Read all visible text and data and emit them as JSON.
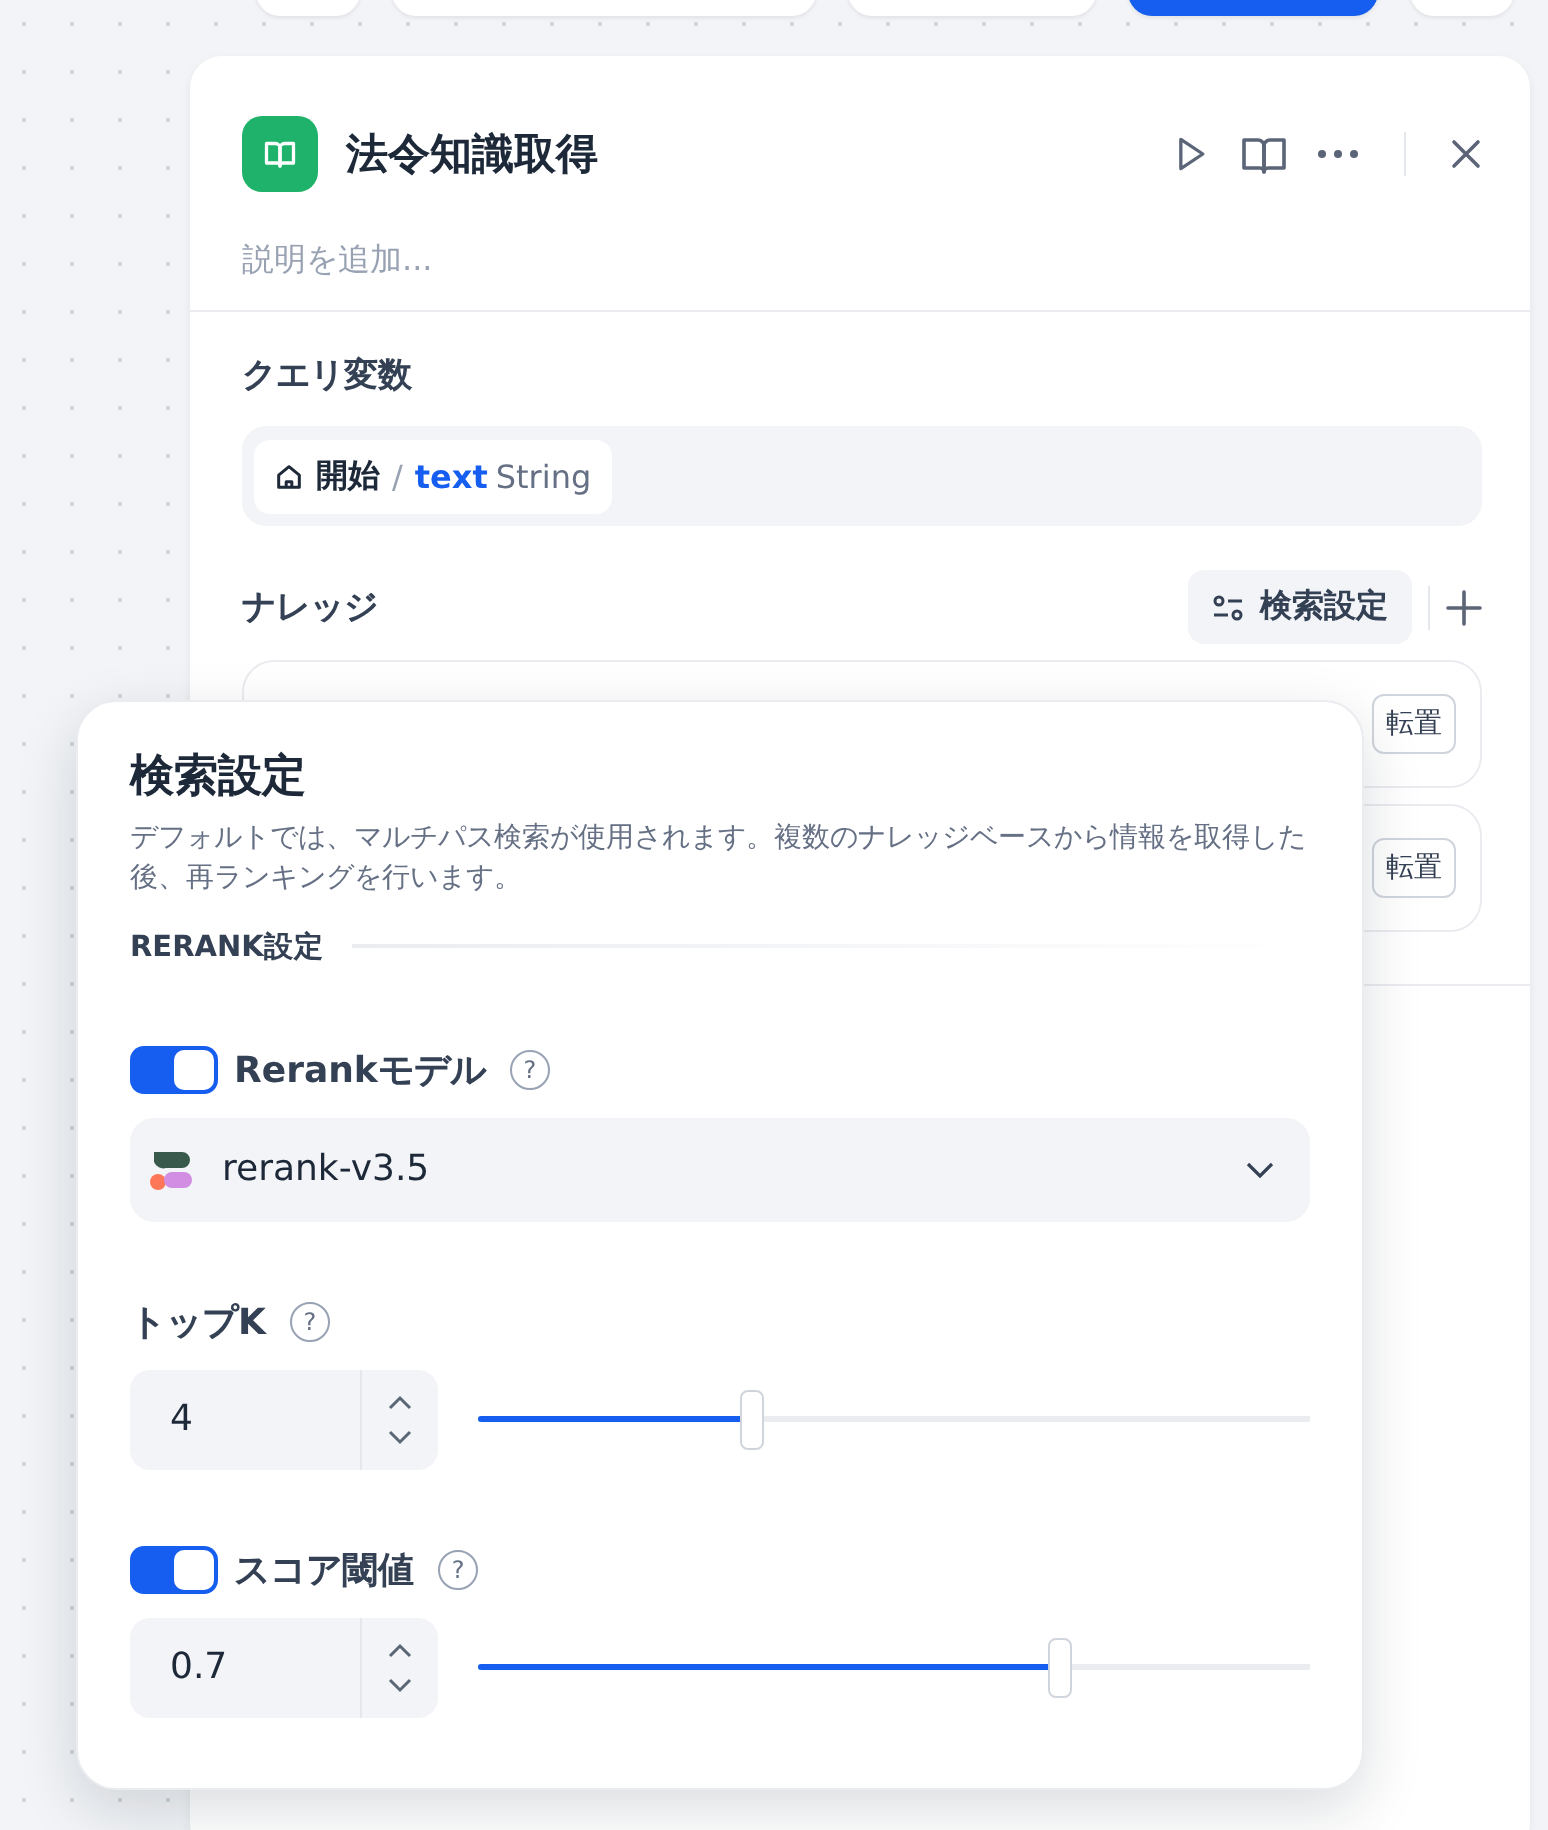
{
  "top_toolbar": {
    "buttons": [
      {
        "kind": "default"
      },
      {
        "kind": "default"
      },
      {
        "kind": "default"
      },
      {
        "kind": "primary"
      },
      {
        "kind": "default"
      }
    ]
  },
  "node": {
    "title": "法令知識取得",
    "description": {
      "placeholder": "説明を追加..."
    },
    "query_variable": {
      "label": "クエリ変数",
      "source": "開始",
      "separator": "/",
      "variable": "text",
      "type": "String"
    },
    "knowledge": {
      "label": "ナレッジ",
      "settings_button": "検索設定",
      "items": [
        {
          "action": "転置"
        },
        {
          "action": "転置"
        }
      ]
    }
  },
  "popover": {
    "title": "検索設定",
    "description": "デフォルトでは、マルチパス検索が使用されます。複数のナレッジベースから情報を取得した後、再ランキングを行います。",
    "section": "RERANK設定",
    "rerank_model": {
      "on": true,
      "label": "Rerankモデル",
      "help": "?",
      "model": "rerank-v3.5"
    },
    "top_k": {
      "label": "トップK",
      "help": "?",
      "value": "4",
      "level": 0.33
    },
    "score_threshold": {
      "on": true,
      "label": "スコア閾値",
      "help": "?",
      "value": "0.7",
      "level": 0.7
    }
  }
}
